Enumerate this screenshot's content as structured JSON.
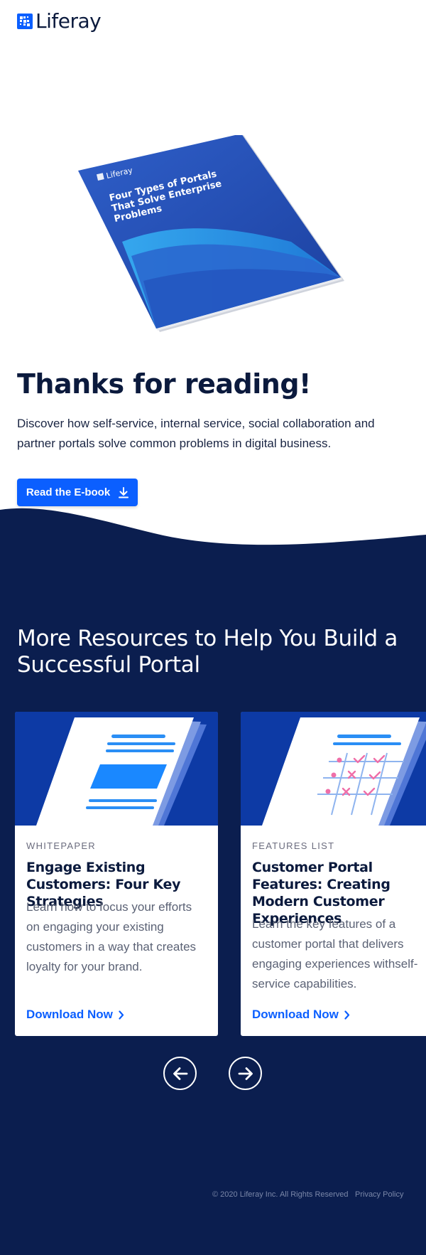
{
  "brand": {
    "name": "Liferay",
    "color": "#0b5fff"
  },
  "book": {
    "brand": "Liferay",
    "title_lines": [
      "Four Types of Portals",
      "That Solve Enterprise",
      "Problems"
    ]
  },
  "hero": {
    "title": "Thanks for reading!",
    "description": "Discover how self-service, internal service, social collaboration and partner portals solve common problems in digital business.",
    "cta_label": "Read the E-book",
    "cta_icon": "download-icon"
  },
  "resources": {
    "title": "More Resources to Help You Build a Successful Portal",
    "cards": [
      {
        "eyebrow": "WHITEPAPER",
        "title": "Engage Existing Customers: Four Key Strategies",
        "body": "Learn how to focus your efforts on engaging your existing customers in a way that creates loyalty for your brand.",
        "link_label": "Download Now",
        "image_icon": "document-icon"
      },
      {
        "eyebrow": "FEATURES LIST",
        "title": "Customer Portal Features: Creating Modern Customer Experiences",
        "body": "Learn the key features of a customer portal that delivers engaging experiences withself-service capabilities.",
        "link_label": "Download Now",
        "image_icon": "checklist-grid-icon"
      }
    ],
    "prev_icon": "arrow-left-icon",
    "next_icon": "arrow-right-icon"
  },
  "footer": {
    "copyright": "© 2020 Liferay Inc. All Rights Reserved",
    "privacy_label": "Privacy Policy"
  },
  "colors": {
    "dark_navy": "#0b1e4f",
    "primary_blue": "#0b5fff",
    "card_image_bg": "#0b3fa8",
    "text_dark": "#0b1a3d",
    "pink_marks": "#ef6ea8"
  }
}
